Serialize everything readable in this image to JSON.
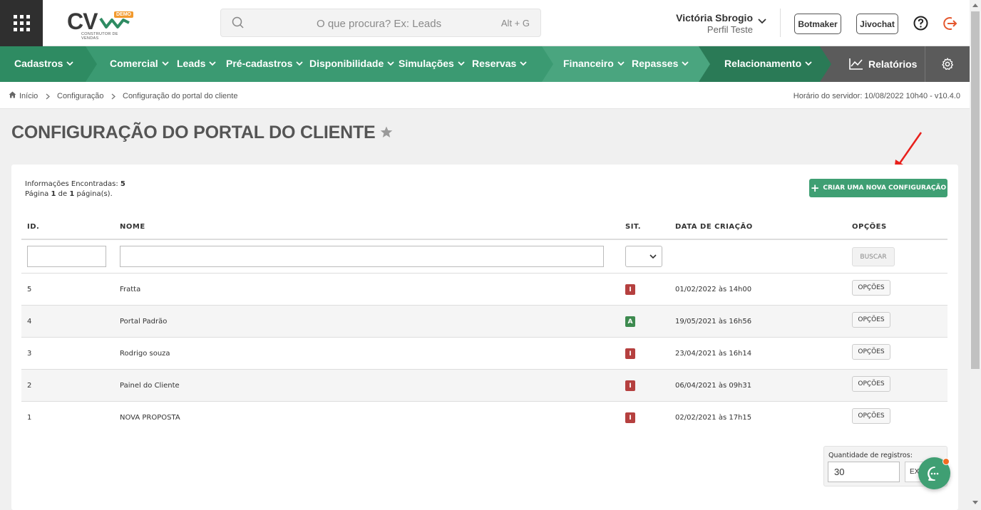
{
  "header": {
    "logo_text": "CV",
    "logo_badge": "DEMO",
    "logo_subtitle": "CONSTRUTOR DE VENDAS",
    "search_placeholder": "O que procura? Ex: Leads",
    "search_shortcut": "Alt + G",
    "user_name": "Victória Sbrogio",
    "user_role": "Perfil Teste",
    "botmaker_label": "Botmaker",
    "jivochat_label": "Jivochat"
  },
  "nav": {
    "items": [
      {
        "label": "Cadastros"
      },
      {
        "label": "Comercial"
      },
      {
        "label": "Leads"
      },
      {
        "label": "Pré-cadastros"
      },
      {
        "label": "Disponibilidade"
      },
      {
        "label": "Simulações"
      },
      {
        "label": "Reservas"
      },
      {
        "label": "Financeiro"
      },
      {
        "label": "Repasses"
      },
      {
        "label": "Relacionamento"
      }
    ],
    "reports_label": "Relatórios"
  },
  "breadcrumb": {
    "items": [
      "Início",
      "Configuração",
      "Configuração do portal do cliente"
    ],
    "server_time": "Horário do servidor: 10/08/2022 10h40 - v10.4.0"
  },
  "page": {
    "title": "CONFIGURAÇÃO DO PORTAL DO CLIENTE",
    "info_found_label": "Informações Encontradas:",
    "info_found_value": "5",
    "page_word": "Página",
    "page_current": "1",
    "page_of": "de",
    "page_total": "1",
    "page_suffix": "página(s).",
    "create_button": "CRIAR UMA NOVA CONFIGURAÇÃO"
  },
  "table": {
    "headers": {
      "id": "ID.",
      "name": "NOME",
      "sit": "SIT.",
      "date": "DATA DE CRIAÇÃO",
      "options": "OPÇÕES"
    },
    "search_button": "BUSCAR",
    "rows": [
      {
        "id": "5",
        "name": "Fratta",
        "status": "I",
        "date": "01/02/2022 às 14h00",
        "options": "OPÇÕES"
      },
      {
        "id": "4",
        "name": "Portal Padrão",
        "status": "A",
        "date": "19/05/2021 às 16h56",
        "options": "OPÇÕES"
      },
      {
        "id": "3",
        "name": "Rodrigo souza",
        "status": "I",
        "date": "23/04/2021 às 16h14",
        "options": "OPÇÕES"
      },
      {
        "id": "2",
        "name": "Painel do Cliente",
        "status": "I",
        "date": "06/04/2021 às 09h31",
        "options": "OPÇÕES"
      },
      {
        "id": "1",
        "name": "NOVA PROPOSTA",
        "status": "I",
        "date": "02/02/2021 às 17h15",
        "options": "OPÇÕES"
      }
    ]
  },
  "records": {
    "label": "Quantidade de registros:",
    "value": "30",
    "export_label": "EX"
  },
  "colors": {
    "primary_green": "#2e8b62",
    "inactive": "#b5403f",
    "active": "#3d8a4f",
    "logout": "#e4572e"
  }
}
